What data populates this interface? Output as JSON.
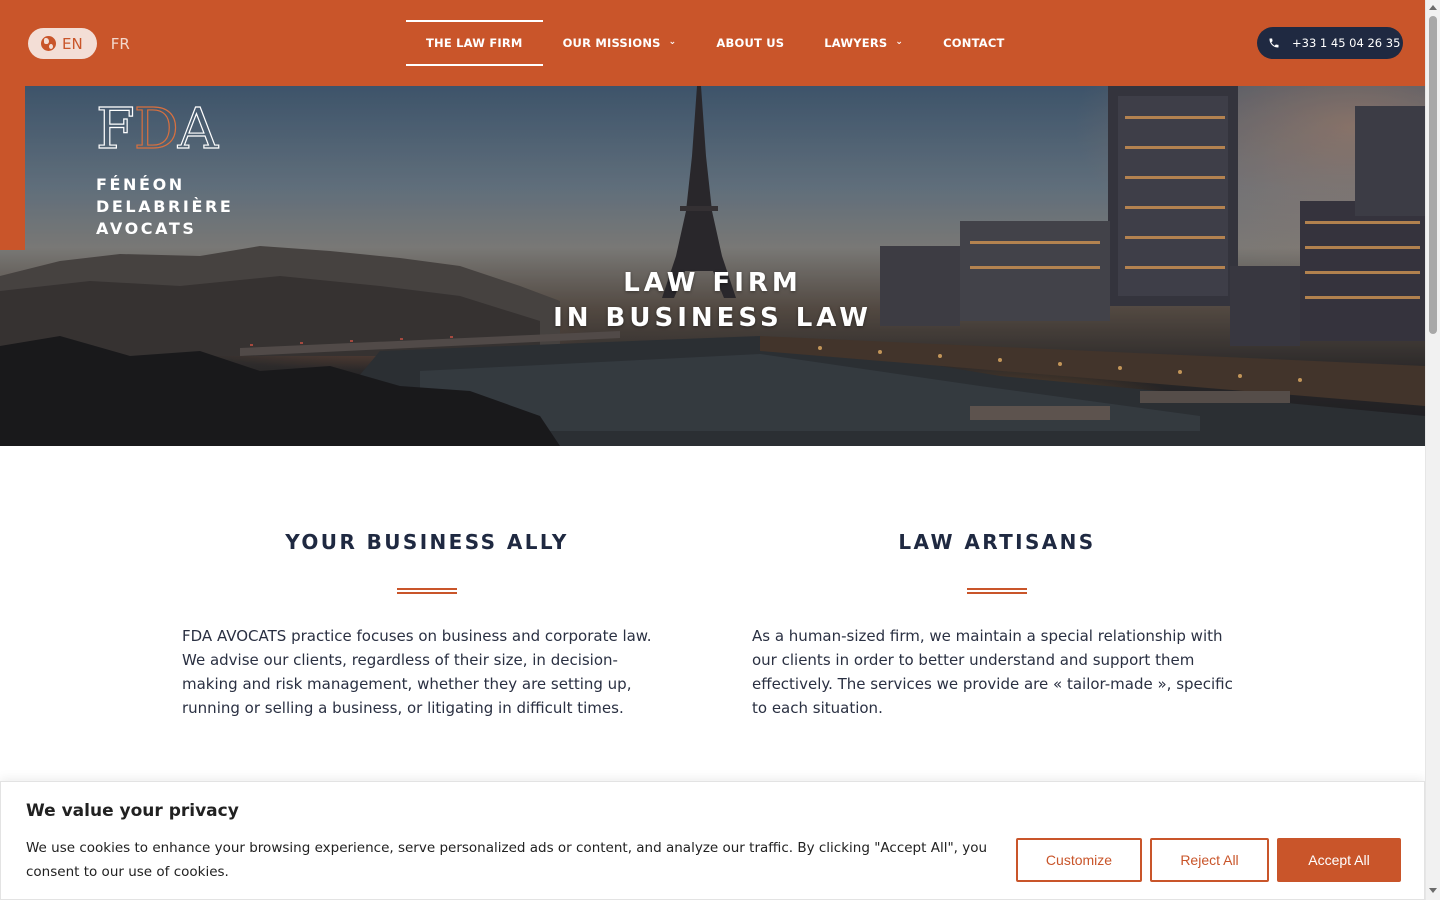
{
  "header": {
    "language": {
      "active": "EN",
      "other": "FR"
    },
    "nav": [
      {
        "label": "THE LAW FIRM",
        "active": true,
        "has_dropdown": false
      },
      {
        "label": "OUR MISSIONS",
        "active": false,
        "has_dropdown": true
      },
      {
        "label": "ABOUT US",
        "active": false,
        "has_dropdown": false
      },
      {
        "label": "LAWYERS",
        "active": false,
        "has_dropdown": true
      },
      {
        "label": "CONTACT",
        "active": false,
        "has_dropdown": false
      }
    ],
    "phone": "+33 1 45 04 26 35"
  },
  "hero": {
    "logo": {
      "mark": {
        "f": "F",
        "d": "D",
        "a": "A"
      },
      "lines": [
        "FÉNÉON",
        "DELABRIÈRE",
        "AVOCATS"
      ]
    },
    "title_line1": "LAW FIRM",
    "title_line2": "IN BUSINESS LAW"
  },
  "sections": [
    {
      "title": "YOUR BUSINESS ALLY",
      "text": "FDA AVOCATS practice focuses on business and corporate law. We advise our clients, regardless of their size, in decision-making and risk management, whether they are setting up, running or selling a business, or litigating in difficult times."
    },
    {
      "title": "LAW ARTISANS",
      "text": "As a human-sized firm, we maintain a special relationship with our clients in order to better understand and support them effectively. The services we provide are « tailor-made », specific to each situation."
    }
  ],
  "cookie_banner": {
    "title": "We value your privacy",
    "text": "We use cookies to enhance your browsing experience, serve personalized ads or content, and analyze our traffic. By clicking \"Accept All\", you consent to our use of cookies.",
    "customize_label": "Customize",
    "reject_label": "Reject All",
    "accept_label": "Accept All"
  },
  "colors": {
    "brand": "#c9552a",
    "navy": "#1f2941",
    "text": "#2a3042"
  },
  "icons": {
    "language": "globe-icon",
    "phone": "phone-icon",
    "dropdown": "chevron-down-icon"
  }
}
